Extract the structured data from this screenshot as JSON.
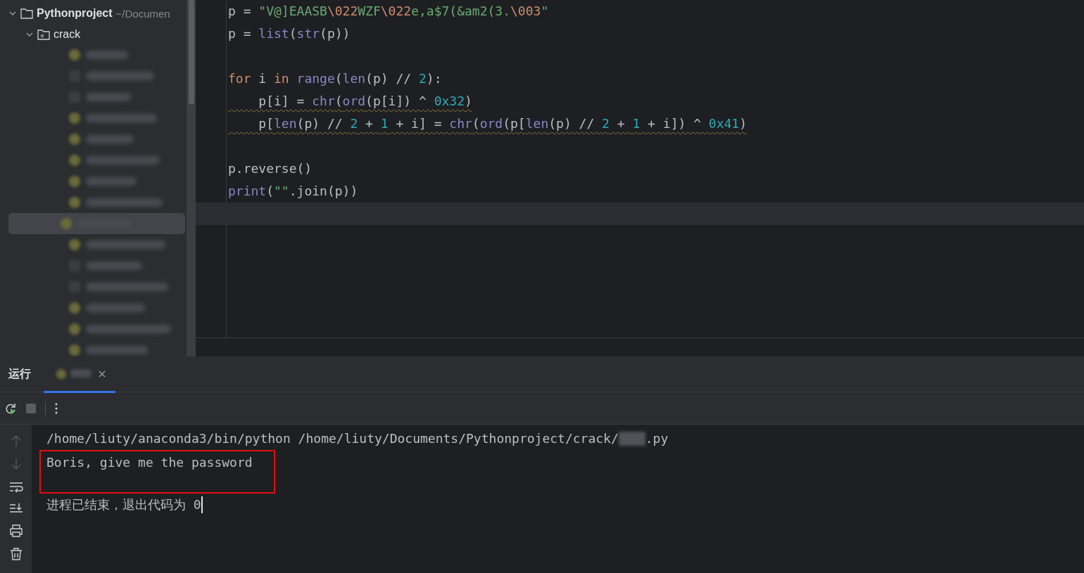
{
  "project_tree": {
    "root": {
      "name": "Pythonproject",
      "path": "~/Documen",
      "expanded": true
    },
    "folder": {
      "name": "crack",
      "expanded": true
    },
    "files": [
      {
        "kind": "python",
        "selected": false
      },
      {
        "kind": "plain",
        "selected": false
      },
      {
        "kind": "plain",
        "selected": false
      },
      {
        "kind": "python",
        "selected": false
      },
      {
        "kind": "python",
        "selected": false
      },
      {
        "kind": "python",
        "selected": false
      },
      {
        "kind": "python",
        "selected": false
      },
      {
        "kind": "python",
        "selected": false
      },
      {
        "kind": "python",
        "selected": true
      },
      {
        "kind": "python",
        "selected": false
      },
      {
        "kind": "plain",
        "selected": false
      },
      {
        "kind": "plain",
        "selected": false
      },
      {
        "kind": "python",
        "selected": false
      },
      {
        "kind": "python",
        "selected": false
      },
      {
        "kind": "python",
        "selected": false
      }
    ]
  },
  "editor": {
    "lines": [
      {
        "kind": "code",
        "warning": false,
        "current": false,
        "tokens": [
          {
            "kind": "text",
            "text": "p = "
          },
          {
            "kind": "string",
            "text": "\"V@]EAASB"
          },
          {
            "kind": "escape",
            "text": "\\022"
          },
          {
            "kind": "string",
            "text": "WZF"
          },
          {
            "kind": "escape",
            "text": "\\022"
          },
          {
            "kind": "string",
            "text": "e,a$7(&am2(3."
          },
          {
            "kind": "escape",
            "text": "\\003"
          },
          {
            "kind": "string",
            "text": "\""
          }
        ]
      },
      {
        "kind": "code",
        "warning": false,
        "current": false,
        "tokens": [
          {
            "kind": "text",
            "text": "p = "
          },
          {
            "kind": "builtin",
            "text": "list"
          },
          {
            "kind": "text",
            "text": "("
          },
          {
            "kind": "builtin",
            "text": "str"
          },
          {
            "kind": "text",
            "text": "(p))"
          }
        ]
      },
      {
        "kind": "blank"
      },
      {
        "kind": "code",
        "warning": false,
        "current": false,
        "tokens": [
          {
            "kind": "keyword",
            "text": "for"
          },
          {
            "kind": "text",
            "text": " i "
          },
          {
            "kind": "keyword",
            "text": "in"
          },
          {
            "kind": "builtin",
            "text": " range"
          },
          {
            "kind": "text",
            "text": "("
          },
          {
            "kind": "builtin",
            "text": "len"
          },
          {
            "kind": "text",
            "text": "(p) // "
          },
          {
            "kind": "number",
            "text": "2"
          },
          {
            "kind": "text",
            "text": "):"
          }
        ]
      },
      {
        "kind": "code",
        "warning": true,
        "current": false,
        "tokens": [
          {
            "kind": "text",
            "text": "    p[i] = "
          },
          {
            "kind": "builtin",
            "text": "chr"
          },
          {
            "kind": "text",
            "text": "("
          },
          {
            "kind": "builtin",
            "text": "ord"
          },
          {
            "kind": "text",
            "text": "(p[i]) ^ "
          },
          {
            "kind": "number",
            "text": "0x32"
          },
          {
            "kind": "text",
            "text": ")"
          }
        ]
      },
      {
        "kind": "code",
        "warning": true,
        "current": false,
        "tokens": [
          {
            "kind": "text",
            "text": "    p["
          },
          {
            "kind": "builtin",
            "text": "len"
          },
          {
            "kind": "text",
            "text": "(p) // "
          },
          {
            "kind": "number",
            "text": "2"
          },
          {
            "kind": "text",
            "text": " + "
          },
          {
            "kind": "number",
            "text": "1"
          },
          {
            "kind": "text",
            "text": " + i] = "
          },
          {
            "kind": "builtin",
            "text": "chr"
          },
          {
            "kind": "text",
            "text": "("
          },
          {
            "kind": "builtin",
            "text": "ord"
          },
          {
            "kind": "text",
            "text": "(p["
          },
          {
            "kind": "builtin",
            "text": "len"
          },
          {
            "kind": "text",
            "text": "(p) // "
          },
          {
            "kind": "number",
            "text": "2"
          },
          {
            "kind": "text",
            "text": " + "
          },
          {
            "kind": "number",
            "text": "1"
          },
          {
            "kind": "text",
            "text": " + i]) ^ "
          },
          {
            "kind": "number",
            "text": "0x41"
          },
          {
            "kind": "text",
            "text": ")"
          }
        ]
      },
      {
        "kind": "blank"
      },
      {
        "kind": "code",
        "warning": false,
        "current": false,
        "tokens": [
          {
            "kind": "text",
            "text": "p.reverse()"
          }
        ]
      },
      {
        "kind": "code",
        "warning": false,
        "current": false,
        "tokens": [
          {
            "kind": "builtin",
            "text": "print"
          },
          {
            "kind": "text",
            "text": "("
          },
          {
            "kind": "string",
            "text": "\"\""
          },
          {
            "kind": "text",
            "text": ".join(p))"
          }
        ]
      },
      {
        "kind": "blank",
        "current": true
      }
    ]
  },
  "run_panel": {
    "title": "运行",
    "tabs": [
      {
        "selected": true
      }
    ],
    "console": {
      "command": "/home/liuty/anaconda3/bin/python /home/liuty/Documents/Pythonproject/crack/",
      "command_suffix": ".py",
      "output": "Boris, give me the password",
      "exit_message": "进程已结束，退出代码为 0"
    }
  }
}
